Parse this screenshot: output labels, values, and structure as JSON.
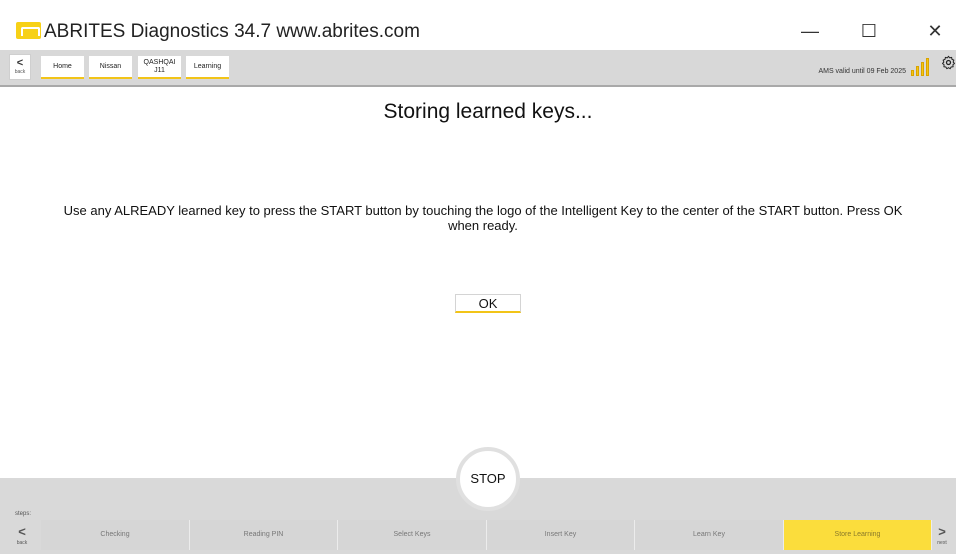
{
  "window": {
    "title": "ABRITES Diagnostics 34.7   www.abrites.com",
    "minimize_glyph": "—",
    "maximize_glyph": "☐",
    "close_glyph": "✕"
  },
  "nav": {
    "back_glyph": "<",
    "back_label": "back",
    "crumbs": [
      "Home",
      "Nissan",
      "QASHQAI\nJ11",
      "Learning"
    ],
    "ams_status": "AMS valid until 09 Feb 2025",
    "settings_icon": "gear-icon",
    "signal_icon": "signal-bars-icon"
  },
  "main": {
    "title": "Storing learned keys...",
    "instruction": "Use any ALREADY learned key to press the START button by touching the logo of the Intelligent Key to the center of the START button. Press OK when ready.",
    "ok_label": "OK"
  },
  "footer": {
    "stop_label": "STOP",
    "steps_label": "steps:",
    "back_glyph": "<",
    "back_label": "back",
    "next_glyph": ">",
    "next_label": "next",
    "steps": [
      "Checking",
      "Reading PIN",
      "Select Keys",
      "Insert Key",
      "Learn Key",
      "Store Learning"
    ],
    "active_step": "Store Learning"
  },
  "colors": {
    "accent": "#f2c418",
    "active_step": "#fbdd3c",
    "bar_bg": "#d8d8d8"
  }
}
